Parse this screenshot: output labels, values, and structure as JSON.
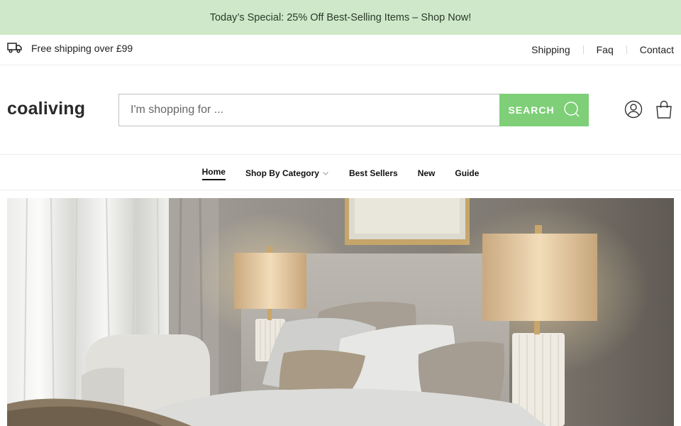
{
  "announcement": {
    "text": "Today’s Special: 25% Off Best-Selling Items – Shop Now!"
  },
  "utility": {
    "shipping_note": "Free shipping over £99",
    "links": [
      "Shipping",
      "Faq",
      "Contact"
    ]
  },
  "header": {
    "logo": "coaliving",
    "search": {
      "placeholder": "I'm shopping for ...",
      "button_label": "SEARCH"
    },
    "icons": [
      "user-icon",
      "shopping-bag-icon"
    ]
  },
  "nav": {
    "items": [
      "Home",
      "Shop By Category",
      "Best Sellers",
      "New",
      "Guide"
    ],
    "active": "Home"
  },
  "colors": {
    "announcement_bg": "#cfe8c9",
    "accent": "#7ecf77"
  },
  "hero": {
    "image": "bedroom-scene-lamps-pillows"
  }
}
